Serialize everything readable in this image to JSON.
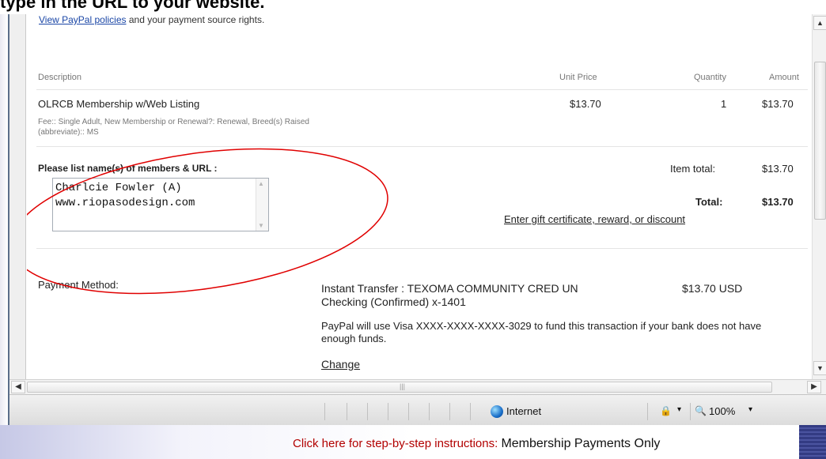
{
  "caption": {
    "top": "type in the URL to your website."
  },
  "page": {
    "policy_link": "View PayPal policies",
    "policy_rest": " and your payment source rights.",
    "table": {
      "headers": {
        "description": "Description",
        "unit_price": "Unit Price",
        "quantity": "Quantity",
        "amount": "Amount"
      },
      "item": {
        "name": "OLRCB Membership w/Web Listing",
        "fee_line1": "Fee:: Single Adult, New Membership or Renewal?: Renewal, Breed(s) Raised",
        "fee_line2": "(abbreviate):: MS",
        "unit_price": "$13.70",
        "quantity": "1",
        "amount": "$13.70"
      }
    },
    "members_label": "Please list name(s) of members & URL :",
    "members_text": "Charlcie Fowler (A)\nwww.riopasodesign.com",
    "item_total_label": "Item total:",
    "item_total": "$13.70",
    "total_label": "Total:",
    "total": "$13.70",
    "gift_link": "Enter gift certificate, reward, or discount",
    "payment": {
      "label": "Payment Method:",
      "method_line1": "Instant Transfer : TEXOMA COMMUNITY CRED UN",
      "method_line2": "Checking (Confirmed) x-1401",
      "amount": "$13.70 USD",
      "note_line1": "PayPal will use Visa XXXX-XXXX-XXXX-3029 to fund this transaction if your bank does not have",
      "note_line2": "enough funds.",
      "change_link": "Change"
    }
  },
  "statusbar": {
    "zone": "Internet",
    "zoom": "100%",
    "zoom_arrow": "▾",
    "security_arrow": "▾"
  },
  "footer": {
    "link_prefix": "Click here for step-by-step instructions: ",
    "link_bold": "Membership Payments Only"
  },
  "icons": {
    "globe": "globe-icon",
    "zoom": "magnifier-icon",
    "security": "lock-icon"
  },
  "colors": {
    "link": "#1a46a6",
    "annotation_circle": "#e00000",
    "footer_link": "#b20000"
  }
}
